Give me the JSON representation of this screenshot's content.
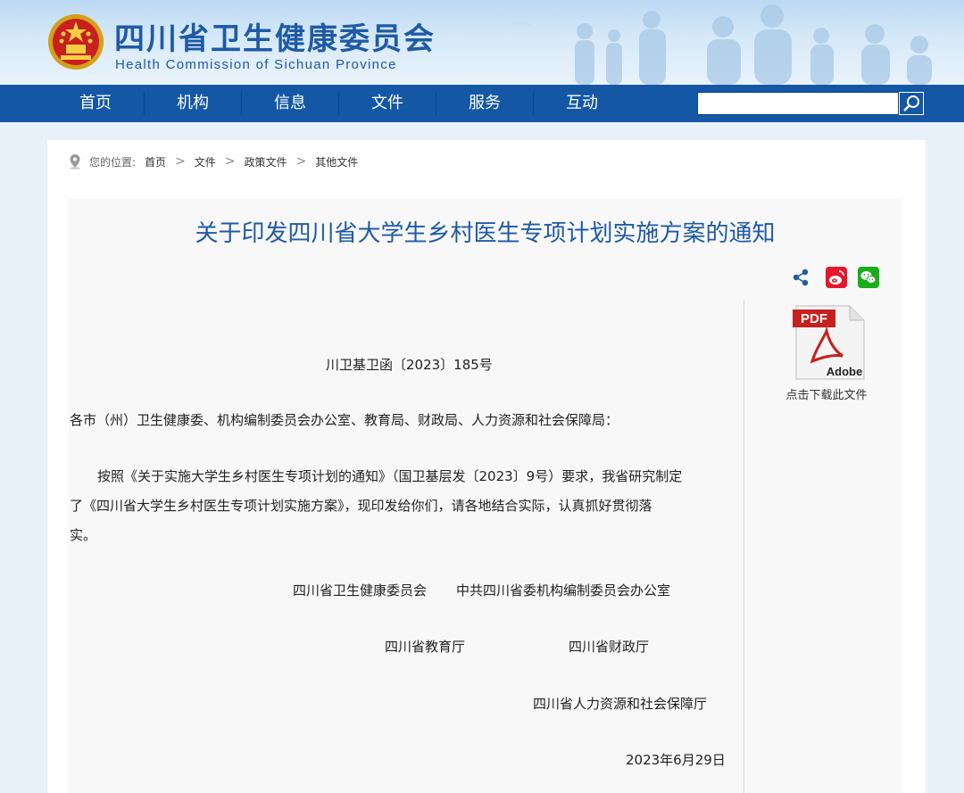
{
  "header": {
    "title_cn": "四川省卫生健康委员会",
    "title_en": "Health Commission of Sichuan Province"
  },
  "nav": {
    "items": [
      "首页",
      "机构",
      "信息",
      "文件",
      "服务",
      "互动"
    ],
    "search_placeholder": ""
  },
  "breadcrumb": {
    "label": "您的位置:",
    "items": [
      "首页",
      "文件",
      "政策文件",
      "其他文件"
    ],
    "separator": ">"
  },
  "article": {
    "title": "关于印发四川省大学生乡村医生专项计划实施方案的通知",
    "doc_number": "川卫基卫函〔2023〕185号",
    "recipients": "各市（州）卫生健康委、机构编制委员会办公室、教育局、财政局、人力资源和社会保障局：",
    "body_line1": "按照《关于实施大学生乡村医生专项计划的通知》（国卫基层发〔2023〕9号）要求，我省研究制定",
    "body_line2": "了《四川省大学生乡村医生专项计划实施方案》，现印发给你们，请各地结合实际，认真抓好贯彻落",
    "body_line3": "实。",
    "signer1": "四川省卫生健康委员会",
    "signer2": "中共四川省委机构编制委员会办公室",
    "signer3": "四川省教育厅",
    "signer4": "四川省财政厅",
    "signer5": "四川省人力资源和社会保障厅",
    "date": "2023年6月29日"
  },
  "sidebar": {
    "pdf_badge": "PDF",
    "pdf_brand": "Adobe",
    "download_label": "点击下载此文件"
  },
  "icons": [
    "location-pin-icon",
    "share-icon",
    "weibo-icon",
    "wechat-icon",
    "search-icon",
    "pdf-icon"
  ],
  "colors": {
    "nav_bg": "#1357a5",
    "title_blue": "#1f5aa6",
    "weibo_red": "#e6162d",
    "wechat_green": "#1aad19",
    "pdf_red": "#c8201e"
  }
}
